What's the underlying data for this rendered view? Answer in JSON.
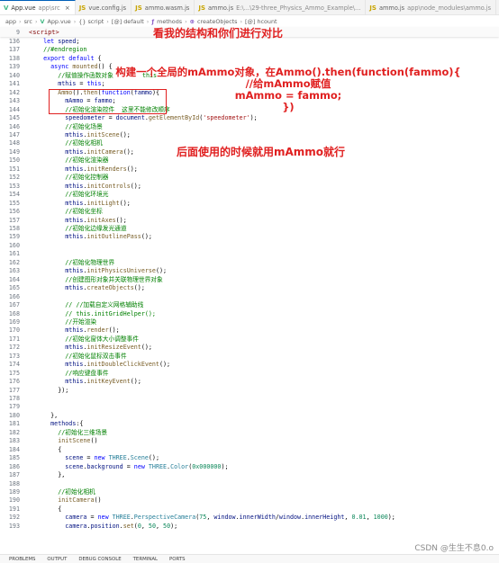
{
  "tabs": [
    {
      "icon": "vue-file-icon",
      "glyph": "V",
      "kind": "vue",
      "name": "App.vue",
      "desc": "app\\src",
      "close": "×",
      "active": true
    },
    {
      "icon": "js-file-icon",
      "glyph": "JS",
      "kind": "js",
      "name": "vue.config.js",
      "desc": "",
      "close": "",
      "active": false
    },
    {
      "icon": "js-file-icon",
      "glyph": "JS",
      "kind": "js",
      "name": "ammo.wasm.js",
      "desc": "",
      "close": "",
      "active": false
    },
    {
      "icon": "js-file-icon",
      "glyph": "JS",
      "kind": "js",
      "name": "ammo.js",
      "desc": "E:\\...\\29-three_Physics_Ammo_Example\\...",
      "close": "",
      "active": false
    },
    {
      "icon": "js-file-icon",
      "glyph": "JS",
      "kind": "js",
      "name": "ammo.js",
      "desc": "app\\node_modules\\ammo.js",
      "close": "",
      "active": false
    }
  ],
  "breadcrumb": [
    {
      "text": "app",
      "icon": ""
    },
    {
      "text": "src",
      "icon": ""
    },
    {
      "text": "App.vue",
      "icon": "V"
    },
    {
      "text": "{} script",
      "icon": ""
    },
    {
      "text": "[@] default",
      "icon": ""
    },
    {
      "text": "methods",
      "icon": "ƒ"
    },
    {
      "text": "createObjects",
      "icon": "⊕"
    },
    {
      "text": "[@] hcount",
      "icon": ""
    }
  ],
  "sticky": {
    "line": "9",
    "text": "<script>"
  },
  "annotations": {
    "top": "看我的结构和你们进行对比",
    "middle": [
      "构建一个全局的mAmmo对象，在Ammo().then(function(fammo){",
      "//给mAmmo赋值",
      "mAmmo = fammo;",
      "})"
    ],
    "bottom": "后面使用的时候就用mAmmo就行"
  },
  "code_lines": [
    {
      "n": "136",
      "t": [
        [
          "k",
          "    let "
        ],
        [
          "v",
          "speed"
        ],
        [
          "",
          "; "
        ]
      ]
    },
    {
      "n": "137",
      "t": [
        [
          "c",
          "    //#endregion"
        ]
      ]
    },
    {
      "n": "138",
      "t": [
        [
          "k",
          "    export default "
        ],
        [
          "",
          "{"
        ]
      ]
    },
    {
      "n": "139",
      "t": [
        [
          "k",
          "      async "
        ],
        [
          "f",
          "mounted"
        ],
        [
          "",
          "() {"
        ]
      ]
    },
    {
      "n": "140",
      "t": [
        [
          "c",
          "        //赋值操作函数对象        this"
        ]
      ]
    },
    {
      "n": "141",
      "t": [
        [
          "v",
          "        mthis "
        ],
        [
          "",
          "= "
        ],
        [
          "k",
          "this"
        ],
        [
          "",
          ";"
        ]
      ]
    },
    {
      "n": "142",
      "t": [
        [
          "f",
          "        Ammo"
        ],
        [
          "",
          "()."
        ],
        [
          "f",
          "then"
        ],
        [
          "",
          "("
        ],
        [
          "k",
          "function"
        ],
        [
          "",
          "("
        ],
        [
          "v",
          "fammo"
        ],
        [
          "",
          "){"
        ]
      ]
    },
    {
      "n": "143",
      "t": [
        [
          "v",
          "          mAmmo "
        ],
        [
          "",
          "= "
        ],
        [
          "v",
          "fammo"
        ],
        [
          "",
          ";"
        ]
      ]
    },
    {
      "n": "144",
      "t": [
        [
          "c",
          "          //初始化渲染控件  这里不能修改顺序"
        ]
      ]
    },
    {
      "n": "145",
      "t": [
        [
          "v",
          "          speedometer "
        ],
        [
          "",
          "= "
        ],
        [
          "v",
          "document"
        ],
        [
          "",
          "."
        ],
        [
          "f",
          "getElementById"
        ],
        [
          "",
          "("
        ],
        [
          "s",
          "'speedometer'"
        ],
        [
          "",
          ");"
        ]
      ]
    },
    {
      "n": "146",
      "t": [
        [
          "c",
          "          //初始化场景"
        ]
      ]
    },
    {
      "n": "147",
      "t": [
        [
          "v",
          "          mthis"
        ],
        [
          "",
          "."
        ],
        [
          "f",
          "initScene"
        ],
        [
          "",
          "();"
        ]
      ]
    },
    {
      "n": "148",
      "t": [
        [
          "c",
          "          //初始化相机"
        ]
      ]
    },
    {
      "n": "149",
      "t": [
        [
          "v",
          "          mthis"
        ],
        [
          "",
          "."
        ],
        [
          "f",
          "initCamera"
        ],
        [
          "",
          "();"
        ]
      ]
    },
    {
      "n": "150",
      "t": [
        [
          "c",
          "          //初始化渲染器"
        ]
      ]
    },
    {
      "n": "151",
      "t": [
        [
          "v",
          "          mthis"
        ],
        [
          "",
          "."
        ],
        [
          "f",
          "initRenders"
        ],
        [
          "",
          "();"
        ]
      ]
    },
    {
      "n": "152",
      "t": [
        [
          "c",
          "          //初始化控制器"
        ]
      ]
    },
    {
      "n": "153",
      "t": [
        [
          "v",
          "          mthis"
        ],
        [
          "",
          "."
        ],
        [
          "f",
          "initControls"
        ],
        [
          "",
          "();"
        ]
      ]
    },
    {
      "n": "154",
      "t": [
        [
          "c",
          "          //初始化环境光"
        ]
      ]
    },
    {
      "n": "155",
      "t": [
        [
          "v",
          "          mthis"
        ],
        [
          "",
          "."
        ],
        [
          "f",
          "initLight"
        ],
        [
          "",
          "();"
        ]
      ]
    },
    {
      "n": "156",
      "t": [
        [
          "c",
          "          //初始化坐标"
        ]
      ]
    },
    {
      "n": "157",
      "t": [
        [
          "v",
          "          mthis"
        ],
        [
          "",
          "."
        ],
        [
          "f",
          "initAxes"
        ],
        [
          "",
          "();"
        ]
      ]
    },
    {
      "n": "158",
      "t": [
        [
          "c",
          "          //初始化边缘发光通道"
        ]
      ]
    },
    {
      "n": "159",
      "t": [
        [
          "v",
          "          mthis"
        ],
        [
          "",
          "."
        ],
        [
          "f",
          "initOutlinePass"
        ],
        [
          "",
          "();"
        ]
      ]
    },
    {
      "n": "160",
      "t": [
        [
          "",
          ""
        ]
      ]
    },
    {
      "n": "161",
      "t": [
        [
          "",
          ""
        ]
      ]
    },
    {
      "n": "162",
      "t": [
        [
          "c",
          "          //初始化物理世界"
        ]
      ]
    },
    {
      "n": "163",
      "t": [
        [
          "v",
          "          mthis"
        ],
        [
          "",
          "."
        ],
        [
          "f",
          "initPhysicsUniverse"
        ],
        [
          "",
          "();"
        ]
      ]
    },
    {
      "n": "164",
      "t": [
        [
          "c",
          "          //创建图形对象并关联物理世界对象"
        ]
      ]
    },
    {
      "n": "165",
      "t": [
        [
          "v",
          "          mthis"
        ],
        [
          "",
          "."
        ],
        [
          "f",
          "createObjects"
        ],
        [
          "",
          "();"
        ]
      ]
    },
    {
      "n": "166",
      "t": [
        [
          "",
          ""
        ]
      ]
    },
    {
      "n": "167",
      "t": [
        [
          "c",
          "          // //加载自定义网格辅助线"
        ]
      ]
    },
    {
      "n": "168",
      "t": [
        [
          "c",
          "          // this.initGridHelper();"
        ]
      ]
    },
    {
      "n": "169",
      "t": [
        [
          "c",
          "          //开始渲染"
        ]
      ]
    },
    {
      "n": "170",
      "t": [
        [
          "v",
          "          mthis"
        ],
        [
          "",
          "."
        ],
        [
          "f",
          "render"
        ],
        [
          "",
          "();"
        ]
      ]
    },
    {
      "n": "171",
      "t": [
        [
          "c",
          "          //初始化窗体大小调整事件"
        ]
      ]
    },
    {
      "n": "172",
      "t": [
        [
          "v",
          "          mthis"
        ],
        [
          "",
          "."
        ],
        [
          "f",
          "initResizeEvent"
        ],
        [
          "",
          "();"
        ]
      ]
    },
    {
      "n": "173",
      "t": [
        [
          "c",
          "          //初始化鼠标双击事件"
        ]
      ]
    },
    {
      "n": "174",
      "t": [
        [
          "v",
          "          mthis"
        ],
        [
          "",
          "."
        ],
        [
          "f",
          "initDoubleClickEvent"
        ],
        [
          "",
          "();"
        ]
      ]
    },
    {
      "n": "175",
      "t": [
        [
          "c",
          "          //响应键盘事件"
        ]
      ]
    },
    {
      "n": "176",
      "t": [
        [
          "v",
          "          mthis"
        ],
        [
          "",
          "."
        ],
        [
          "f",
          "initKeyEvent"
        ],
        [
          "",
          "();"
        ]
      ]
    },
    {
      "n": "177",
      "t": [
        [
          "",
          "        });"
        ]
      ]
    },
    {
      "n": "178",
      "t": [
        [
          "",
          ""
        ]
      ]
    },
    {
      "n": "179",
      "t": [
        [
          "",
          ""
        ]
      ]
    },
    {
      "n": "180",
      "t": [
        [
          "",
          "      },"
        ]
      ]
    },
    {
      "n": "181",
      "t": [
        [
          "v",
          "      methods"
        ],
        [
          "",
          ":{"
        ]
      ]
    },
    {
      "n": "182",
      "t": [
        [
          "c",
          "        //初始化三维场景"
        ]
      ]
    },
    {
      "n": "183",
      "t": [
        [
          "f",
          "        initScene"
        ],
        [
          "",
          "()"
        ]
      ]
    },
    {
      "n": "184",
      "t": [
        [
          "",
          "        {"
        ]
      ]
    },
    {
      "n": "185",
      "t": [
        [
          "v",
          "          scene "
        ],
        [
          "",
          "= "
        ],
        [
          "k",
          "new "
        ],
        [
          "t",
          "THREE"
        ],
        [
          "",
          "."
        ],
        [
          "t",
          "Scene"
        ],
        [
          "",
          "();"
        ]
      ]
    },
    {
      "n": "186",
      "t": [
        [
          "v",
          "          scene"
        ],
        [
          "",
          "."
        ],
        [
          "v",
          "background "
        ],
        [
          "",
          "= "
        ],
        [
          "k",
          "new "
        ],
        [
          "t",
          "THREE"
        ],
        [
          "",
          "."
        ],
        [
          "t",
          "Color"
        ],
        [
          "",
          "("
        ],
        [
          "n",
          "0x000000"
        ],
        [
          "",
          ");"
        ]
      ]
    },
    {
      "n": "187",
      "t": [
        [
          "",
          "        },"
        ]
      ]
    },
    {
      "n": "188",
      "t": [
        [
          "",
          ""
        ]
      ]
    },
    {
      "n": "189",
      "t": [
        [
          "c",
          "        //初始化相机"
        ]
      ]
    },
    {
      "n": "190",
      "t": [
        [
          "f",
          "        initCamera"
        ],
        [
          "",
          "()"
        ]
      ]
    },
    {
      "n": "191",
      "t": [
        [
          "",
          "        {"
        ]
      ]
    },
    {
      "n": "192",
      "t": [
        [
          "v",
          "          camera "
        ],
        [
          "",
          "= "
        ],
        [
          "k",
          "new "
        ],
        [
          "t",
          "THREE"
        ],
        [
          "",
          "."
        ],
        [
          "t",
          "PerspectiveCamera"
        ],
        [
          "",
          "("
        ],
        [
          "n",
          "75"
        ],
        [
          "",
          ", "
        ],
        [
          "v",
          "window"
        ],
        [
          "",
          "."
        ],
        [
          "v",
          "innerWidth"
        ],
        [
          "",
          "/"
        ],
        [
          "v",
          "window"
        ],
        [
          "",
          "."
        ],
        [
          "v",
          "innerHeight"
        ],
        [
          "",
          ", "
        ],
        [
          "n",
          "0.01"
        ],
        [
          "",
          ", "
        ],
        [
          "n",
          "1000"
        ],
        [
          "",
          ");"
        ]
      ]
    },
    {
      "n": "193",
      "t": [
        [
          "v",
          "          camera"
        ],
        [
          "",
          "."
        ],
        [
          "v",
          "position"
        ],
        [
          "",
          "."
        ],
        [
          "f",
          "set"
        ],
        [
          "",
          "("
        ],
        [
          "n",
          "0"
        ],
        [
          "",
          ", "
        ],
        [
          "n",
          "50"
        ],
        [
          "",
          ", "
        ],
        [
          "n",
          "50"
        ],
        [
          "",
          ");"
        ]
      ]
    }
  ],
  "panel_tabs": [
    "PROBLEMS",
    "OUTPUT",
    "DEBUG CONSOLE",
    "TERMINAL",
    "PORTS"
  ],
  "watermark": "CSDN @生生不息0.o"
}
